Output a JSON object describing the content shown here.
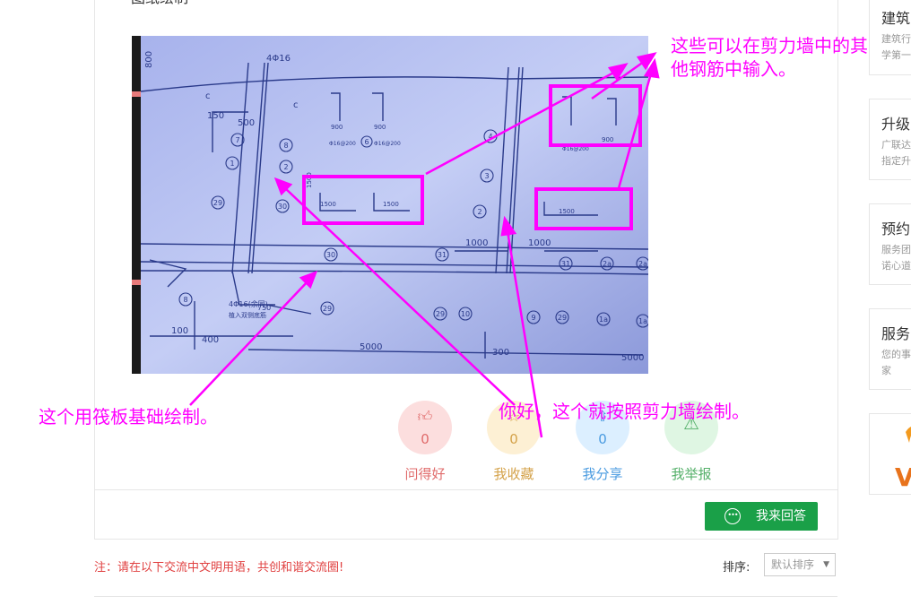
{
  "question": {
    "title_fragment": "图纸绘制"
  },
  "annotations": {
    "top_right": "这些可以在剪力墙中的其他钢筋中输入。",
    "left": "这个用筏板基础绘制。",
    "middle": "你好，这个就按照剪力墙绘制。"
  },
  "drawing": {
    "labels": [
      "4Φ16",
      "800",
      "150",
      "500",
      "c",
      "c",
      "900",
      "900",
      "1500",
      "1500",
      "1500",
      "1500",
      "1000",
      "1000",
      "100",
      "400",
      "5000",
      "300",
      "5000",
      "Φ16@200",
      "Φ16@200",
      "4Φ16(余同)",
      "植入双侧底筋",
      "750",
      "900",
      "Φ16@200"
    ],
    "circle_marks": [
      "1",
      "2",
      "7",
      "8",
      "29",
      "30",
      "29",
      "31",
      "31",
      "2a",
      "2a",
      "30",
      "29",
      "8",
      "29",
      "10",
      "9",
      "29",
      "1a",
      "1a",
      "6",
      "4",
      "3",
      "2",
      "29"
    ]
  },
  "actions": [
    {
      "icon": "thumbs-up-icon",
      "count": "0",
      "label": "问得好"
    },
    {
      "icon": "star-icon",
      "count": "0",
      "label": "我收藏"
    },
    {
      "icon": "share-icon",
      "count": "0",
      "label": "我分享"
    },
    {
      "icon": "warning-icon",
      "count": "",
      "label": "我举报"
    }
  ],
  "answer_button": {
    "label": "我来回答",
    "icon": "chat-bubble-icon"
  },
  "footer": {
    "note": "注：请在以下交流中文明用语，共创和谐交流圈!",
    "sort_label": "排序:",
    "sort_value": "默认排序"
  },
  "sidebar": [
    {
      "title": "建筑",
      "lines": [
        "建筑行",
        "学第一"
      ]
    },
    {
      "title": "升级",
      "lines": [
        "广联达",
        "指定升"
      ]
    },
    {
      "title": "预约",
      "lines": [
        "服务团",
        "诺心道"
      ]
    },
    {
      "title": "服务",
      "lines": [
        "您的事",
        "家"
      ]
    },
    {
      "title": "",
      "lines": []
    }
  ],
  "colors": {
    "accent_green": "#1aa048",
    "annotation_magenta": "#ff00ff",
    "note_red": "#e04040"
  }
}
